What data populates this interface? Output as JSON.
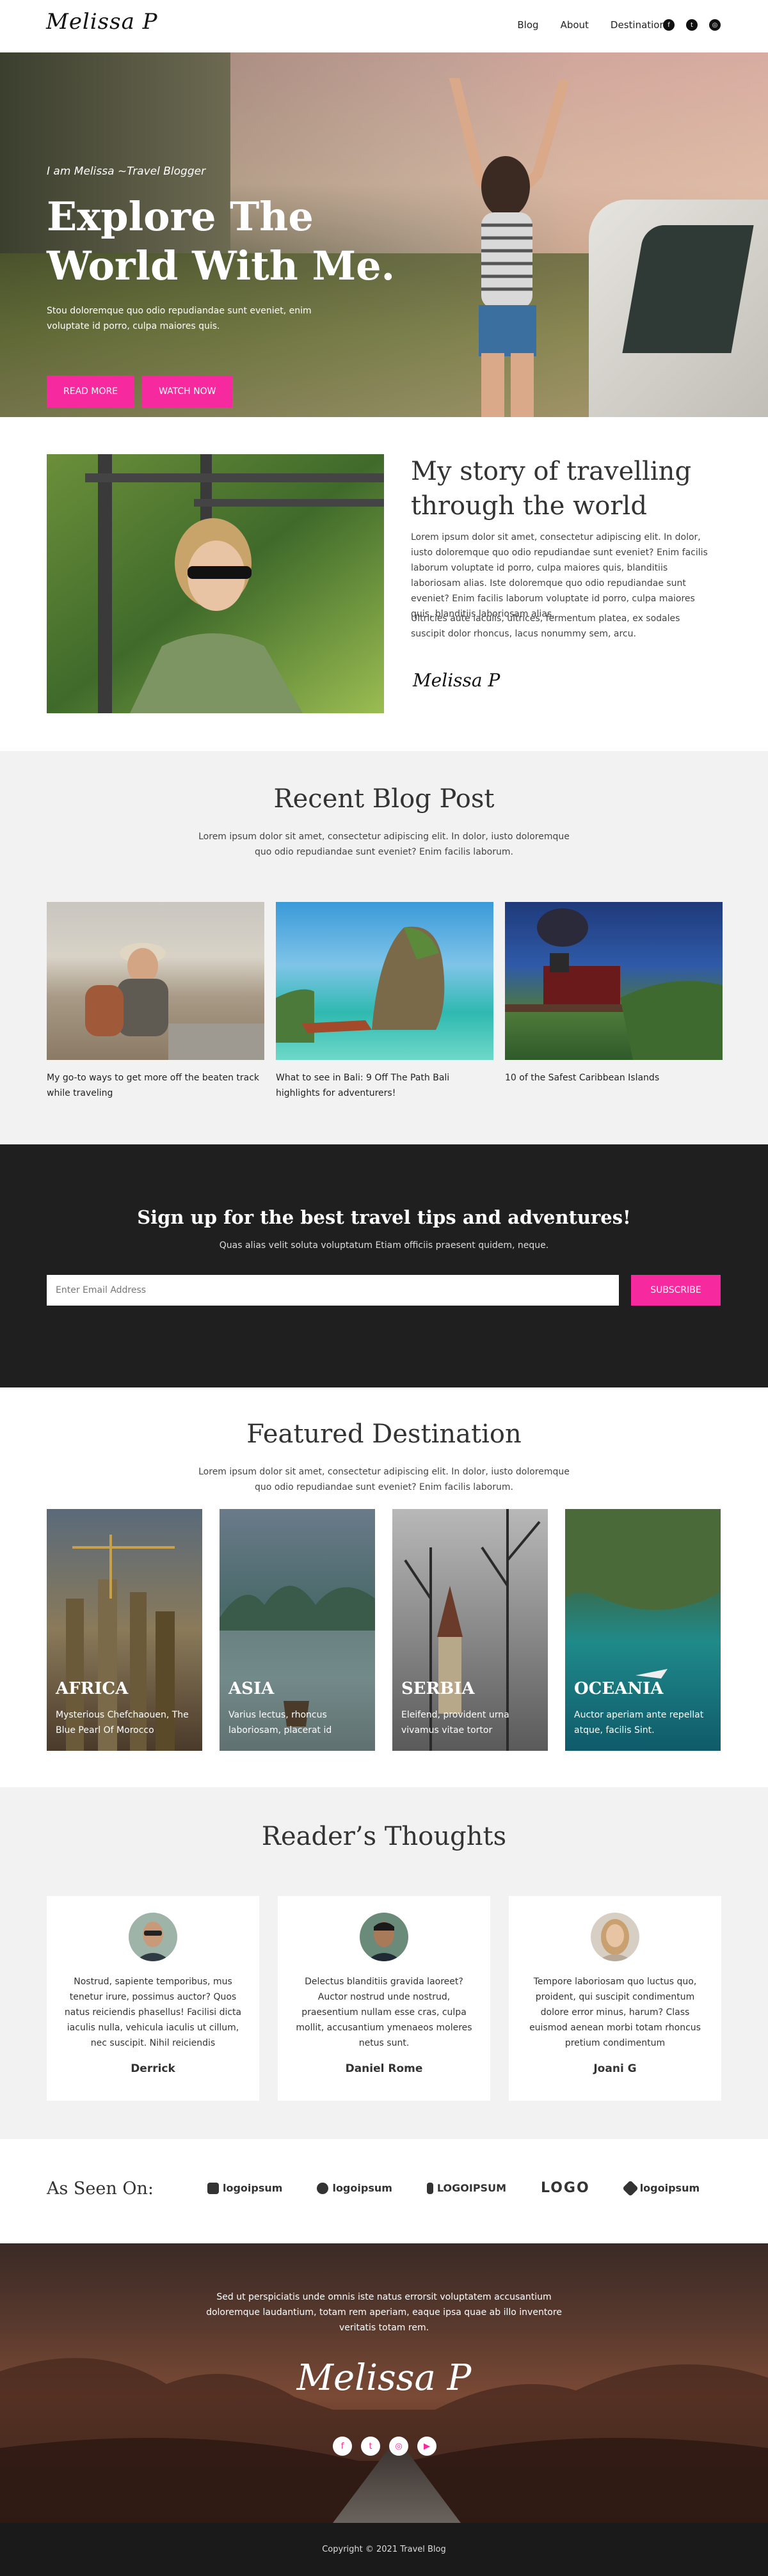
{
  "header": {
    "logo": "Melissa P",
    "nav": [
      "Blog",
      "About",
      "Destination"
    ],
    "social_icons": [
      "facebook-icon",
      "twitter-icon",
      "instagram-icon"
    ]
  },
  "hero": {
    "tagline": "I am Melissa ~Travel Blogger",
    "title_line1": "Explore The",
    "title_line2": "World With Me.",
    "text": "Stou doloremque quo odio repudiandae sunt eveniet, enim voluptate id porro, culpa maiores quis.",
    "btn_read": "READ MORE",
    "btn_watch": "WATCH NOW"
  },
  "story": {
    "title": "My story of travelling through the world",
    "para1": "Lorem ipsum dolor sit amet, consectetur adipiscing elit. In dolor, iusto doloremque quo odio repudiandae sunt eveniet? Enim facilis laborum voluptate id porro, culpa maiores quis, blanditiis laboriosam alias. Iste doloremque quo odio repudiandae sunt eveniet? Enim facilis laborum voluptate id porro, culpa maiores quis, blanditiis laboriosam alias.",
    "para2": "Ultricies aute iaculis, ultrices, fermentum platea, ex sodales suscipit dolor rhoncus, lacus nonummy sem, arcu.",
    "signature": "Melissa P"
  },
  "recent": {
    "title": "Recent Blog Post",
    "subtitle": "Lorem ipsum dolor sit amet, consectetur adipiscing elit. In dolor, iusto doloremque quo odio repudiandae sunt eveniet? Enim facilis laborum.",
    "posts": [
      {
        "caption": "My go-to ways to get more off the beaten track while traveling"
      },
      {
        "caption": "What to see in Bali: 9 Off The Path Bali highlights for adventurers!"
      },
      {
        "caption": "10 of the Safest Caribbean Islands"
      }
    ]
  },
  "signup": {
    "title": "Sign up for the best travel tips and adventures!",
    "subtitle": "Quas alias velit soluta voluptatum Etiam officiis praesent quidem, neque.",
    "placeholder": "Enter Email Address",
    "button": "SUBSCRIBE"
  },
  "featured": {
    "title": "Featured Destination",
    "subtitle": "Lorem ipsum dolor sit amet, consectetur adipiscing elit. In dolor, iusto doloremque quo odio repudiandae sunt eveniet? Enim facilis laborum.",
    "destinations": [
      {
        "name": "AFRICA",
        "desc": "Mysterious Chefchaouen, The Blue Pearl Of Morocco"
      },
      {
        "name": "ASIA",
        "desc": "Varius lectus, rhoncus laboriosam, placerat id"
      },
      {
        "name": "SERBIA",
        "desc": "Eleifend, provident urna vivamus vitae tortor"
      },
      {
        "name": "OCEANIA",
        "desc": "Auctor aperiam ante repellat atque, facilis Sint."
      }
    ]
  },
  "readers": {
    "title": "Reader’s Thoughts",
    "testimonials": [
      {
        "quote": "Nostrud, sapiente temporibus, mus tenetur irure, possimus auctor? Quos natus reiciendis phasellus! Facilisi dicta iaculis nulla, vehicula iaculis ut cillum, nec suscipit. Nihil reiciendis",
        "name": "Derrick"
      },
      {
        "quote": "Delectus blanditiis gravida laoreet? Auctor nostrud unde nostrud, praesentium nullam esse cras, culpa mollit, accusantium ymenaeos moleres netus sunt.",
        "name": "Daniel Rome"
      },
      {
        "quote": "Tempore laboriosam quo luctus quo, proident, qui suscipit condimentum dolore error minus, harum? Class euismod aenean morbi totam rhoncus pretium condimentum",
        "name": "Joani G"
      }
    ]
  },
  "seen": {
    "label": "As Seen On:",
    "logos": [
      "logoipsum",
      "logoipsum",
      "LOGOIPSUM",
      "LOGO",
      "logoipsum"
    ]
  },
  "footer": {
    "text": "Sed ut perspiciatis unde omnis iste natus errorsit voluptatem accusantium doloremque laudantium, totam rem aperiam, eaque ipsa quae ab illo inventore veritatis totam rem.",
    "signature": "Melissa P",
    "social_icons": [
      "facebook-icon",
      "twitter-icon",
      "instagram-icon",
      "youtube-icon"
    ],
    "copyright": "Copyright © 2021 Travel Blog"
  },
  "colors": {
    "accent": "#f6299e",
    "dark": "#1f1f1f",
    "light_bg": "#f2f2f2"
  }
}
